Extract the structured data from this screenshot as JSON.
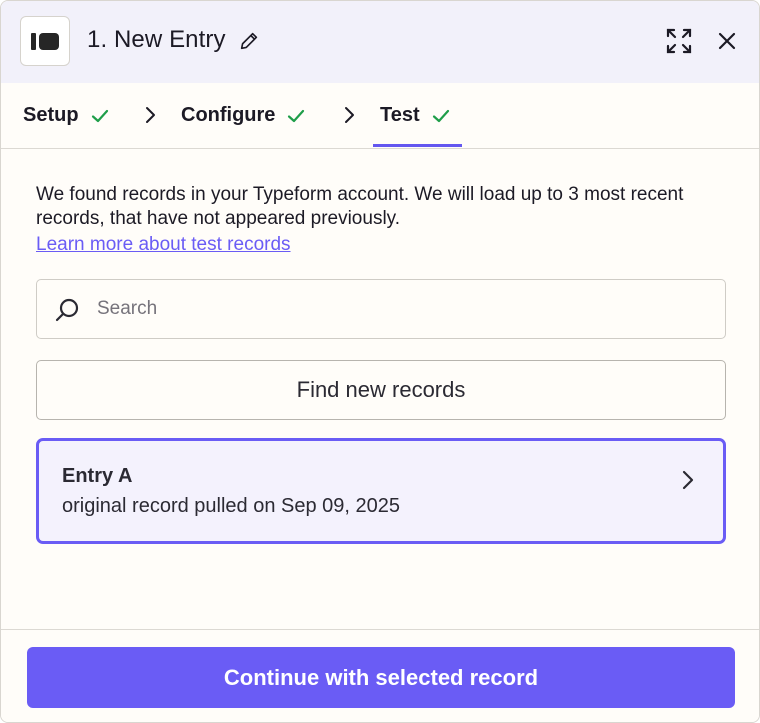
{
  "header": {
    "title": "1. New Entry",
    "icons": [
      "app-logo-icon",
      "pencil-icon",
      "expand-icon",
      "close-icon"
    ]
  },
  "tabs": [
    {
      "label": "Setup",
      "complete": true
    },
    {
      "label": "Configure",
      "complete": true
    },
    {
      "label": "Test",
      "complete": true,
      "active": true
    }
  ],
  "main": {
    "description": "We found records in your Typeform account. We will load up to 3 most recent records, that have not appeared previously.",
    "learn_more_link": "Learn more about test records",
    "search": {
      "placeholder": "Search",
      "value": ""
    },
    "find_button": "Find new records",
    "records": [
      {
        "title": "Entry A",
        "subtitle": "original record pulled on Sep 09, 2025",
        "selected": true
      }
    ]
  },
  "footer": {
    "continue_button": "Continue with selected record"
  },
  "colors": {
    "accent": "#6a5cf5",
    "success": "#1f9e4a",
    "header_bg": "#f2f1fa"
  }
}
